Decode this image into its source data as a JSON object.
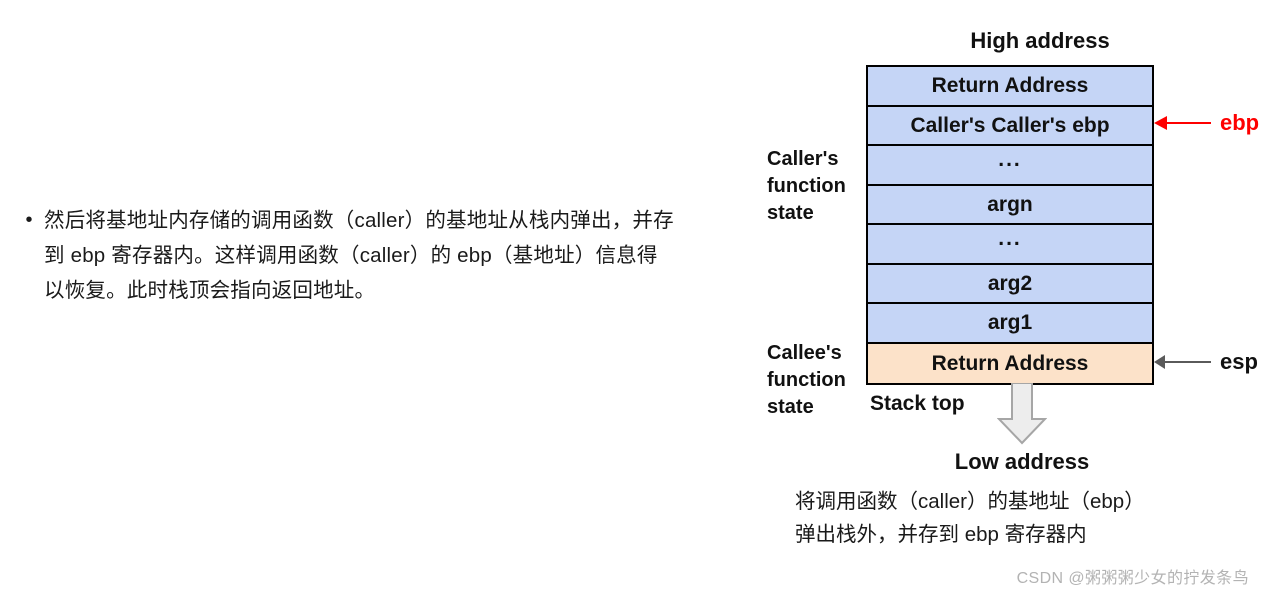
{
  "left_panel": {
    "bullet_marker": "•",
    "body_text": "然后将基地址内存储的调用函数（caller）的基地址从栈内弹出，并存到 ebp 寄存器内。这样调用函数（caller）的 ebp（基地址）信息得以恢复。此时栈顶会指向返回地址。"
  },
  "diagram": {
    "high_address_label": "High address",
    "low_address_label": "Low address",
    "stack_top_label": "Stack top",
    "caller_group_label": "Caller's function state",
    "callee_group_label": "Callee's function state",
    "rows": [
      {
        "label": "Return Address",
        "fill": "blue",
        "kind": "text"
      },
      {
        "label": "Caller's Caller's ebp",
        "fill": "blue",
        "kind": "text"
      },
      {
        "label": "...",
        "fill": "blue",
        "kind": "ellipsis"
      },
      {
        "label": "argn",
        "fill": "blue",
        "kind": "text"
      },
      {
        "label": "...",
        "fill": "blue",
        "kind": "ellipsis"
      },
      {
        "label": "arg2",
        "fill": "blue",
        "kind": "text"
      },
      {
        "label": "arg1",
        "fill": "blue",
        "kind": "text"
      },
      {
        "label": "Return Address",
        "fill": "orange",
        "kind": "text"
      }
    ],
    "pointers": {
      "ebp_label": "ebp",
      "esp_label": "esp"
    },
    "colors": {
      "blue_fill": "#c5d5f6",
      "orange_fill": "#fce2c9",
      "border": "#000000",
      "ebp_arrow": "#fe0000",
      "esp_arrow": "#5a5a5a",
      "block_arrow_fill": "#ededed",
      "block_arrow_stroke": "#a6a6a6"
    },
    "caption": "将调用函数（caller）的基地址（ebp）\n弹出栈外，并存到 ebp 寄存器内"
  },
  "watermark": {
    "text": "CSDN @粥粥粥少女的拧发条鸟"
  }
}
